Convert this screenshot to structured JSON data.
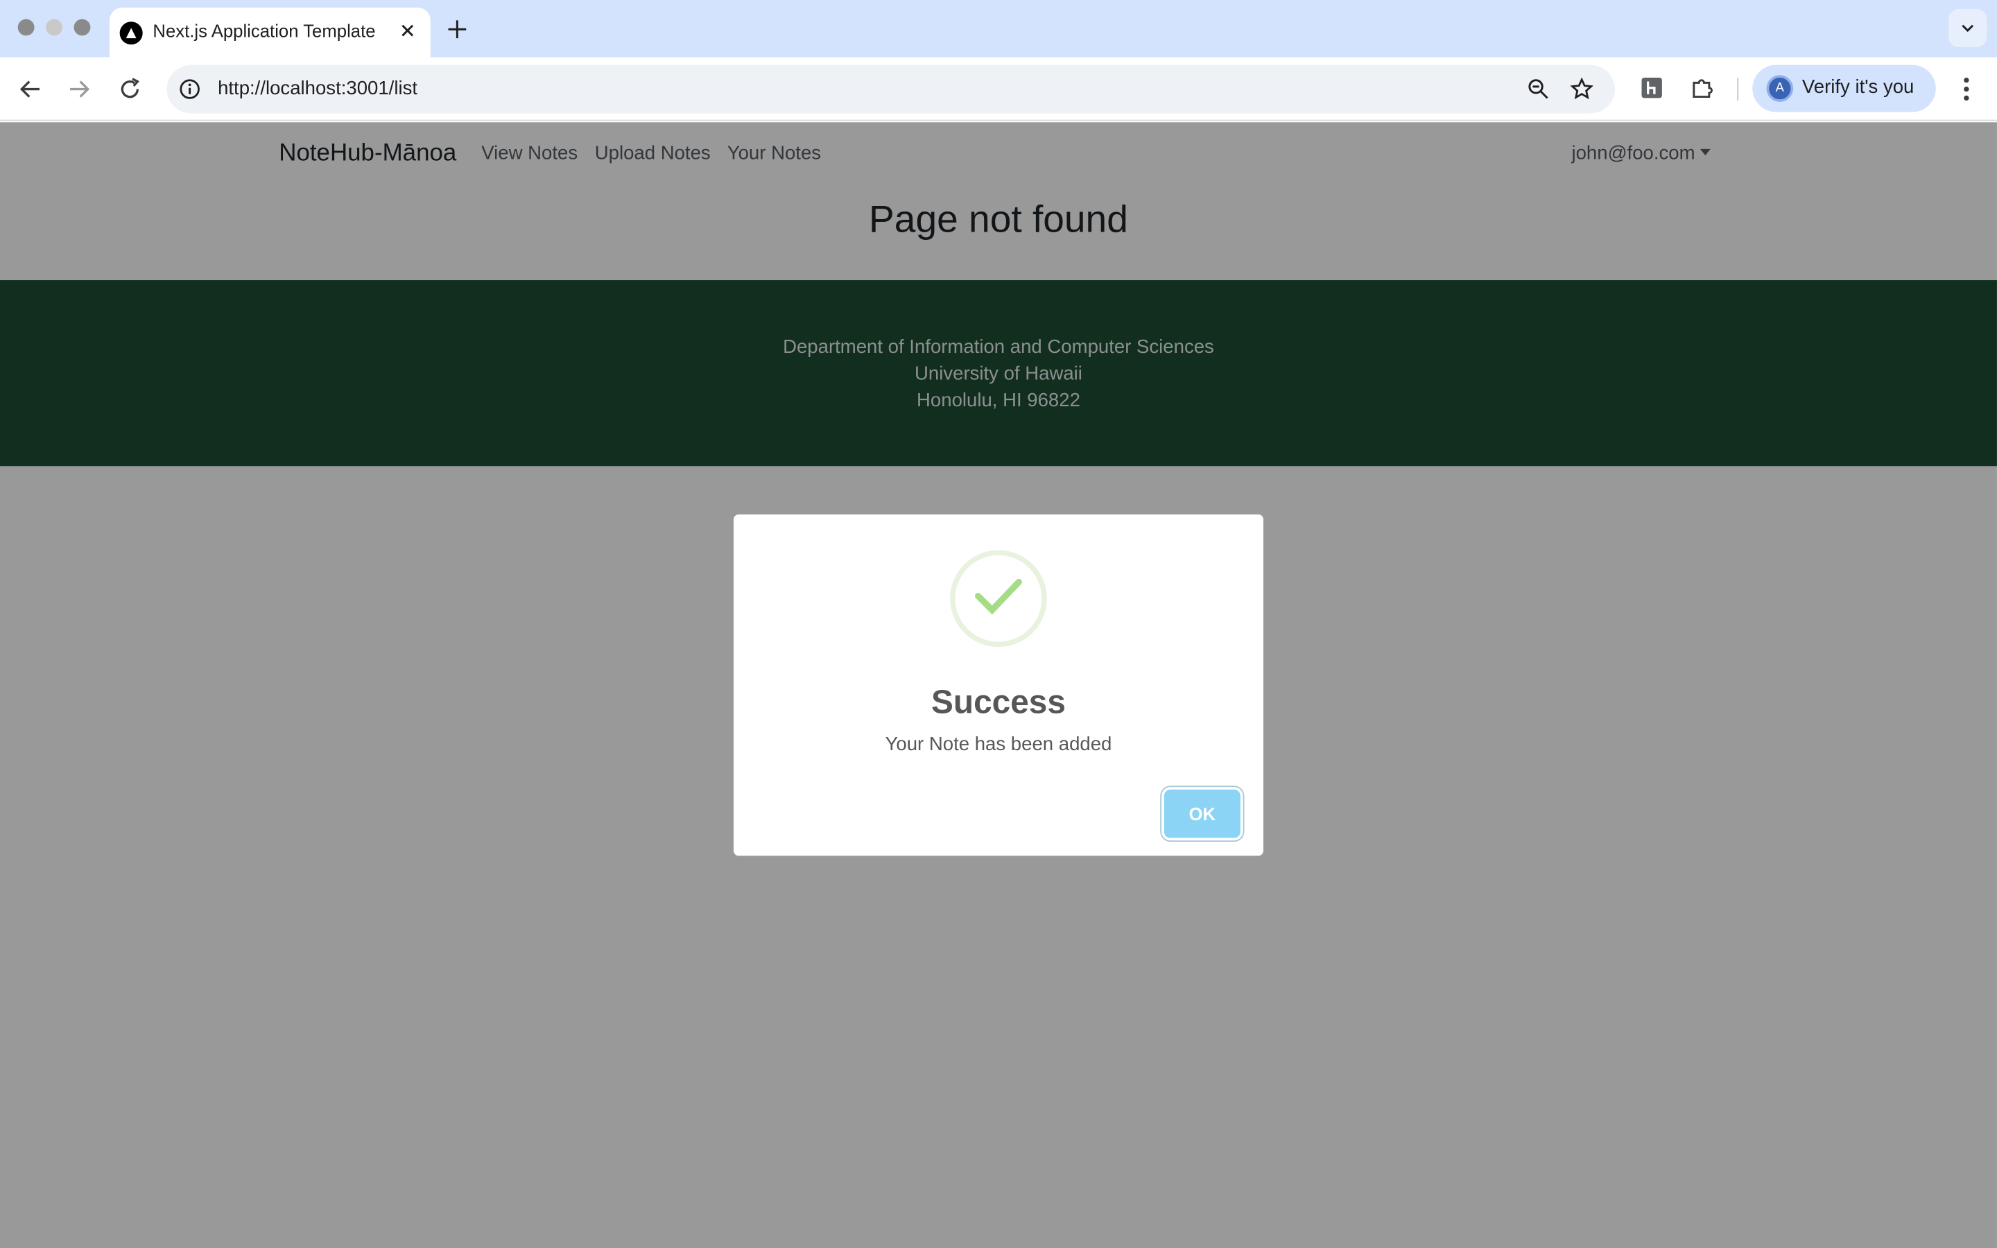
{
  "browser": {
    "tab_title": "Next.js Application Template",
    "url": "http://localhost:3001/list",
    "verify_label": "Verify it's you",
    "avatar_letter": "A"
  },
  "navbar": {
    "brand": "NoteHub-Mānoa",
    "links": [
      "View Notes",
      "Upload Notes",
      "Your Notes"
    ],
    "user": "john@foo.com"
  },
  "main": {
    "heading": "Page not found"
  },
  "footer": {
    "lines": [
      "Department of Information and Computer Sciences",
      "University of Hawaii",
      "Honolulu, HI 96822"
    ]
  },
  "modal": {
    "title": "Success",
    "text": "Your Note has been added",
    "ok_label": "OK",
    "icon": "checkmark-icon"
  },
  "colors": {
    "footer_bg": "#1d4d33",
    "ok_button": "#8cd4f5",
    "checkmark": "#a5dc86",
    "tabstrip": "#d3e3fd"
  }
}
